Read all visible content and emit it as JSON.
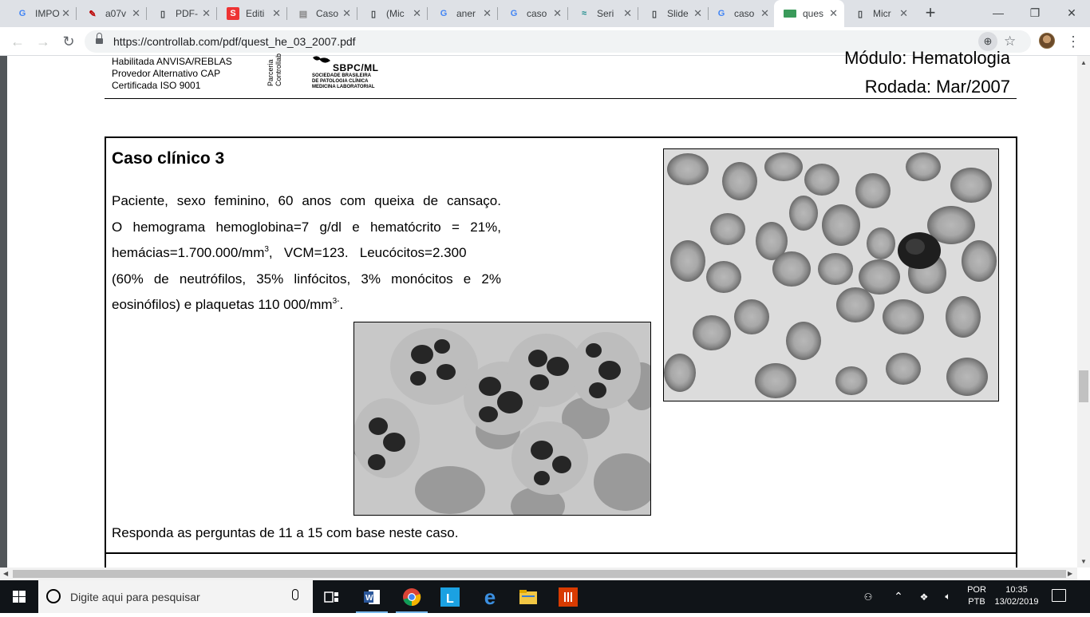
{
  "browser": {
    "tabs": [
      {
        "title": "IMPO",
        "icon": "google-icon"
      },
      {
        "title": "a07v",
        "icon": "pen-icon"
      },
      {
        "title": "PDF-",
        "icon": "document-icon"
      },
      {
        "title": "Editi",
        "icon": "scribd-icon"
      },
      {
        "title": "Caso",
        "icon": "slides-icon"
      },
      {
        "title": "(Mic",
        "icon": "document-icon"
      },
      {
        "title": "aner",
        "icon": "google-icon"
      },
      {
        "title": "caso",
        "icon": "google-icon"
      },
      {
        "title": "Seri",
        "icon": "wave-icon"
      },
      {
        "title": "Slide",
        "icon": "document-icon"
      },
      {
        "title": "caso",
        "icon": "google-icon"
      },
      {
        "title": "ques",
        "icon": "pdf-green-icon"
      },
      {
        "title": "Micr",
        "icon": "document-icon"
      }
    ],
    "url": "https://controllab.com/pdf/quest_he_03_2007.pdf",
    "colors": {
      "tab_strip": "#dee1e6",
      "accent": "#1a73e8"
    }
  },
  "doc": {
    "header": {
      "lines": [
        "Habilitada ANVISA/REBLAS",
        "Provedor Alternativo CAP",
        "Certificada ISO 9001"
      ],
      "parceria": [
        "Parceria",
        "Controllab"
      ],
      "sbpc_abbrev": "SBPC/ML",
      "sbpc_name": [
        "SOCIEDADE BRASILEIRA",
        "DE PATOLOGIA CLÍNICA",
        "MEDICINA LABORATORIAL"
      ],
      "modulo": "Módulo: Hematologia",
      "rodada": "Rodada: Mar/2007"
    },
    "case": {
      "title": "Caso clínico 3",
      "l1": "Paciente, sexo feminino, 60 anos com queixa de cansaço.",
      "l2": "O hemograma hemoglobina=7 g/dl e hematócrito = 21%,",
      "l3a": "hemácias=1.700.000/mm",
      "l3sup": "3",
      "l3b": ",   VCM=123.   Leucócitos=2.300",
      "l4": "(60% de neutrófilos, 35% linfócitos, 3% monócitos e 2%",
      "l5a": "eosinófilos) e plaquetas 110 000/mm",
      "l5sup": "3-",
      "l5b": ".",
      "footer": "Responda as perguntas de 11 a 15 com base neste caso."
    }
  },
  "taskbar": {
    "search_placeholder": "Digite aqui para pesquisar",
    "apps": [
      "task-view-icon",
      "word-icon",
      "chrome-icon",
      "lexicon-icon",
      "edge-icon",
      "file-explorer-icon",
      "office-lens-icon"
    ],
    "lang_top": "POR",
    "lang_bottom": "PTB",
    "time": "10:35",
    "date": "13/02/2019"
  }
}
